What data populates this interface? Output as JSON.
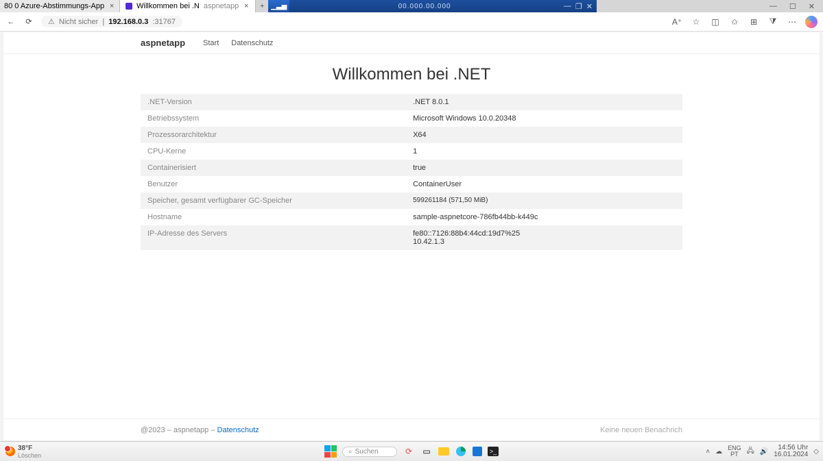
{
  "window": {
    "tab1": "80 0 Azure-Abstimmungs-App",
    "tab2": "Willkommen bei .N",
    "tab2_suffix": "aspnetapp",
    "blue_ip": "00.000.00.000"
  },
  "browser": {
    "insecure": "Nicht sicher",
    "url_bold": "192.168.0.3",
    "url_rest": ":31767"
  },
  "nav": {
    "brand": "aspnetapp",
    "link1": "Start",
    "link2": "Datenschutz"
  },
  "page": {
    "title": "Willkommen bei .NET",
    "rows": [
      {
        "k": ".NET-Version",
        "v": ".NET 8.0.1"
      },
      {
        "k": "Betriebssystem",
        "v": "Microsoft Windows 10.0.20348"
      },
      {
        "k": "Prozessorarchitektur",
        "v": "X64"
      },
      {
        "k": "CPU-Kerne",
        "v": "1"
      },
      {
        "k": "Containerisiert",
        "v": "true"
      },
      {
        "k": "Benutzer",
        "v": "ContainerUser"
      },
      {
        "k": "Speicher, gesamt verfügbarer GC-Speicher",
        "v": "599261184 (571,50 MiB)",
        "muted": true
      },
      {
        "k": "Hostname",
        "v": "sample-aspnetcore-786fb44bb-k449c"
      },
      {
        "k": "IP-Adresse des Servers",
        "v": "fe80::7126:88b4:44cd:19d7%25\n10.42.1.3"
      }
    ]
  },
  "footer": {
    "left_prefix": "@2023 – ",
    "left_app": "aspnetapp",
    "sep": " – ",
    "privacy": "Datenschutz",
    "right": "Keine neuen Benachrich"
  },
  "taskbar": {
    "temp": "38°F",
    "temp_sub": "Löschen",
    "search_placeholder": "Suchen",
    "lang1": "ENG",
    "lang2": "PT",
    "time": "14:56 Uhr",
    "date": "16.01.2024"
  }
}
